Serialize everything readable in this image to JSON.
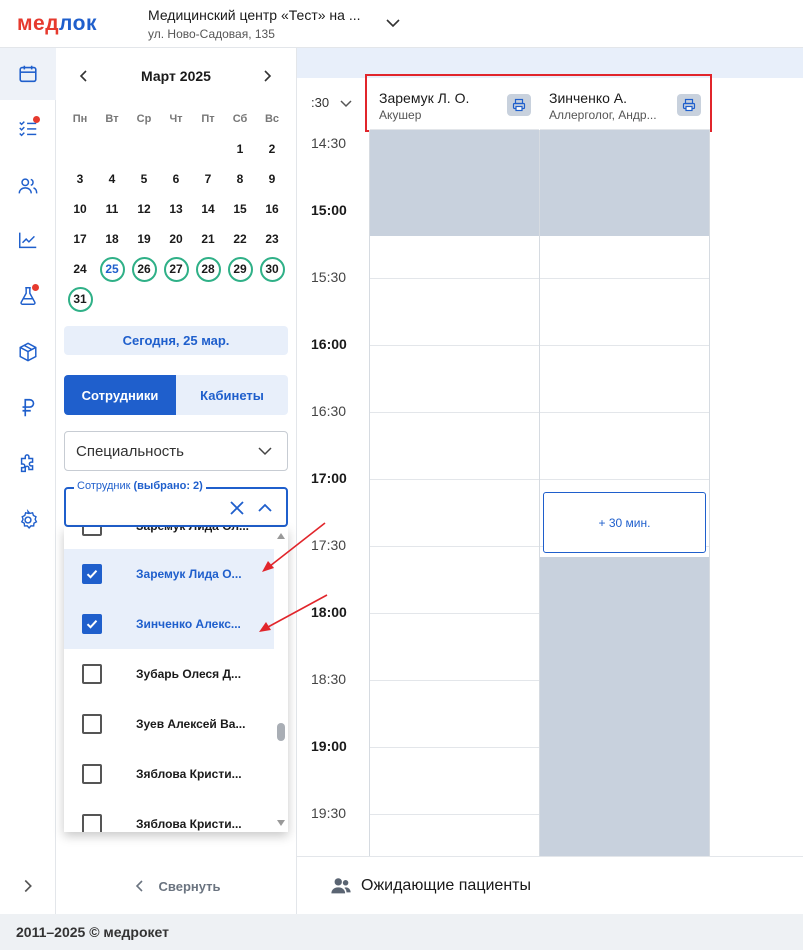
{
  "app": {
    "logo_part1": "мед",
    "logo_part2": "лок",
    "clinic_name": "Медицинский центр «Тест» на ...",
    "clinic_address": "ул. Ново-Садовая, 135",
    "footer_text": "2011–2025 © медрокет"
  },
  "rail": {
    "items": [
      {
        "icon": "calendar-icon",
        "active": true,
        "badge": false
      },
      {
        "icon": "tasks-icon",
        "active": false,
        "badge": true
      },
      {
        "icon": "users-icon",
        "active": false,
        "badge": false
      },
      {
        "icon": "analytics-icon",
        "active": false,
        "badge": false
      },
      {
        "icon": "lab-flask-icon",
        "active": false,
        "badge": true
      },
      {
        "icon": "box-icon",
        "active": false,
        "badge": false
      },
      {
        "icon": "ruble-icon",
        "active": false,
        "badge": false
      },
      {
        "icon": "puzzle-icon",
        "active": false,
        "badge": false
      },
      {
        "icon": "settings-icon",
        "active": false,
        "badge": false
      }
    ],
    "expand_icon": "chevron-right-icon"
  },
  "calendar": {
    "month_title": "Март 2025",
    "weekdays": [
      "Пн",
      "Вт",
      "Ср",
      "Чт",
      "Пт",
      "Сб",
      "Вс"
    ],
    "weeks": [
      [
        "",
        "",
        "",
        "",
        "",
        "1",
        "2"
      ],
      [
        "3",
        "4",
        "5",
        "6",
        "7",
        "8",
        "9"
      ],
      [
        "10",
        "11",
        "12",
        "13",
        "14",
        "15",
        "16"
      ],
      [
        "17",
        "18",
        "19",
        "20",
        "21",
        "22",
        "23"
      ],
      [
        "24",
        "25",
        "26",
        "27",
        "28",
        "29",
        "30"
      ],
      [
        "31",
        "",
        "",
        "",
        "",
        "",
        ""
      ]
    ],
    "marked_days": [
      "25",
      "26",
      "27",
      "28",
      "29",
      "30",
      "31"
    ],
    "today_day": "25",
    "today_button": "Сегодня, 25 мар.",
    "marker_color": "#2fb087"
  },
  "tabs": {
    "employees": "Сотрудники",
    "rooms": "Кабинеты"
  },
  "filters": {
    "specialty_placeholder": "Специальность",
    "employee_label": "Сотрудник",
    "employee_selected": "(выбрано: 2)"
  },
  "dropdown": {
    "items": [
      {
        "label": "Заремук Лида Ол...",
        "checked": false
      },
      {
        "label": "Заремук Лида О...",
        "checked": true
      },
      {
        "label": "Зинченко Алекс...",
        "checked": true
      },
      {
        "label": "Зубарь Олеся Д...",
        "checked": false
      },
      {
        "label": "Зуев Алексей Ва...",
        "checked": false
      },
      {
        "label": "Зяблова Кристи...",
        "checked": false
      },
      {
        "label": "Зяблова Кристи...",
        "checked": false
      }
    ]
  },
  "collapse_label": "Свернуть",
  "schedule": {
    "time_header": ":30",
    "columns": [
      {
        "name": "Заремук Л. О.",
        "specialty": "Акушер"
      },
      {
        "name": "Зинченко А.",
        "specialty": "Аллерголог, Андр..."
      }
    ],
    "times": [
      {
        "label": "14:30",
        "bold": false
      },
      {
        "label": "15:00",
        "bold": true
      },
      {
        "label": "15:30",
        "bold": false
      },
      {
        "label": "16:00",
        "bold": true
      },
      {
        "label": "16:30",
        "bold": false
      },
      {
        "label": "17:00",
        "bold": true
      },
      {
        "label": "17:30",
        "bold": false
      },
      {
        "label": "18:00",
        "bold": true
      },
      {
        "label": "18:30",
        "bold": false
      },
      {
        "label": "19:00",
        "bold": true
      },
      {
        "label": "19:30",
        "bold": false
      }
    ],
    "slot_label": "+ 30 мин.",
    "busy_color": "#c8d1dd",
    "highlight_color": "#e1252b"
  },
  "waiting_label": "Ожидающие пациенты",
  "colors": {
    "primary": "#1f5fcc",
    "brand_red": "#e63a2e",
    "success": "#2fb087"
  }
}
